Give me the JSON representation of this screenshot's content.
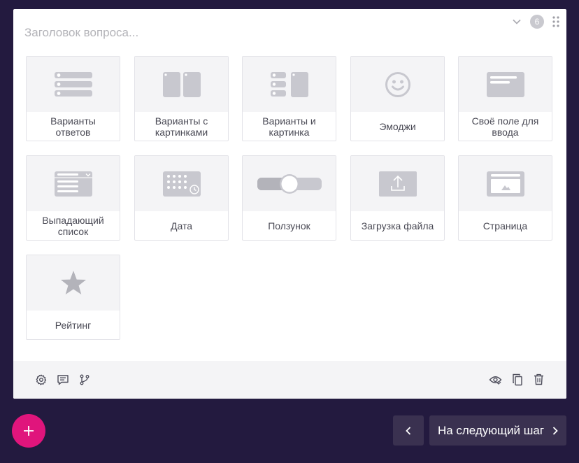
{
  "question": {
    "title_placeholder": "Заголовок вопроса...",
    "count_badge": "6"
  },
  "question_types": [
    {
      "label": "Варианты ответов",
      "icon": "list-options-icon"
    },
    {
      "label": "Варианты с картинками",
      "icon": "image-options-icon"
    },
    {
      "label": "Варианты и картинка",
      "icon": "options-and-image-icon"
    },
    {
      "label": "Эмоджи",
      "icon": "emoji-icon"
    },
    {
      "label": "Своё поле для ввода",
      "icon": "text-field-icon"
    },
    {
      "label": "Выпадающий список",
      "icon": "dropdown-icon"
    },
    {
      "label": "Дата",
      "icon": "calendar-icon"
    },
    {
      "label": "Ползунок",
      "icon": "slider-icon"
    },
    {
      "label": "Загрузка файла",
      "icon": "upload-icon"
    },
    {
      "label": "Страница",
      "icon": "page-icon"
    },
    {
      "label": "Рейтинг",
      "icon": "star-icon"
    }
  ],
  "footer": {
    "left_icons": [
      "gear-icon",
      "comment-icon",
      "branch-icon"
    ],
    "right_icons": [
      "eye-icon",
      "copy-icon",
      "trash-icon"
    ]
  },
  "nav": {
    "next_label": "На следующий шаг"
  },
  "colors": {
    "background": "#231a3f",
    "accent": "#e0157c",
    "nav_button": "#3a3150",
    "icon_gray": "#c8c8cf"
  }
}
